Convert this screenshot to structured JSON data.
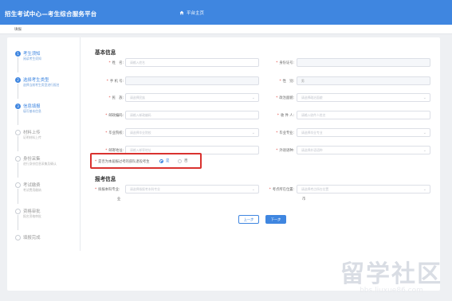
{
  "header": {
    "title": "招生考试中心—考生综合服务平台",
    "home_label": "平台主页"
  },
  "breadcrumb": "填报",
  "steps": [
    {
      "num": "1",
      "title": "考生须知",
      "desc": "阅读考生须知"
    },
    {
      "num": "2",
      "title": "选择考生类型",
      "desc": "选择当前考生类型进行报名"
    },
    {
      "num": "3",
      "title": "信息填报",
      "desc": "填写基本信息"
    },
    {
      "num": "4",
      "title": "材料上传",
      "desc": "证明材料上传"
    },
    {
      "num": "5",
      "title": "身份采集",
      "desc": "进行身份信息采集及确认"
    },
    {
      "num": "6",
      "title": "考试缴费",
      "desc": "考试费用缴纳"
    },
    {
      "num": "7",
      "title": "资格审批",
      "desc": "报名资格审批"
    },
    {
      "num": "8",
      "title": "填报完成",
      "desc": ""
    }
  ],
  "basic_info": {
    "title": "基本信息",
    "name_label": "姓　名:",
    "name_placeholder": "请输入姓名",
    "id_label": "身份证号:",
    "phone_label": "手 机 号:",
    "gender_label": "性　别:",
    "gender_value": "男",
    "ethnicity_label": "民　族:",
    "ethnicity_placeholder": "请选择民族",
    "politics_label": "政治面貌:",
    "politics_placeholder": "请选择政治面貌",
    "postcode_label": "邮政编码:",
    "postcode_placeholder": "请输入邮政编码",
    "recipient_label": "收 件 人:",
    "recipient_placeholder": "请输入收件人姓名",
    "school_label": "毕业院校:",
    "school_placeholder": "请选择毕业院校",
    "major_label": "毕业专业:",
    "major_placeholder": "请选择毕业专业",
    "address_label": "邮寄地址:",
    "address_placeholder": "请输入邮寄地址",
    "exam_type_label": "外语语种:",
    "exam_type_placeholder": "请选择外语语种",
    "retired_question": "是否为本届报过考的部队退役考生",
    "retired_yes": "是",
    "retired_no": "否"
  },
  "exam_info": {
    "title": "报考信息",
    "major_label": "拟报本科专业:",
    "major_placeholder": "请选择拟报考本科专业",
    "major_suffix": "业",
    "site_label": "考点所在位置:",
    "site_placeholder": "请选择考点所在位置",
    "site_suffix": "市"
  },
  "buttons": {
    "prev": "上一步",
    "next": "下一步"
  },
  "watermark": {
    "big": "留学社区",
    "small": "bbs.liuxue86.com"
  }
}
